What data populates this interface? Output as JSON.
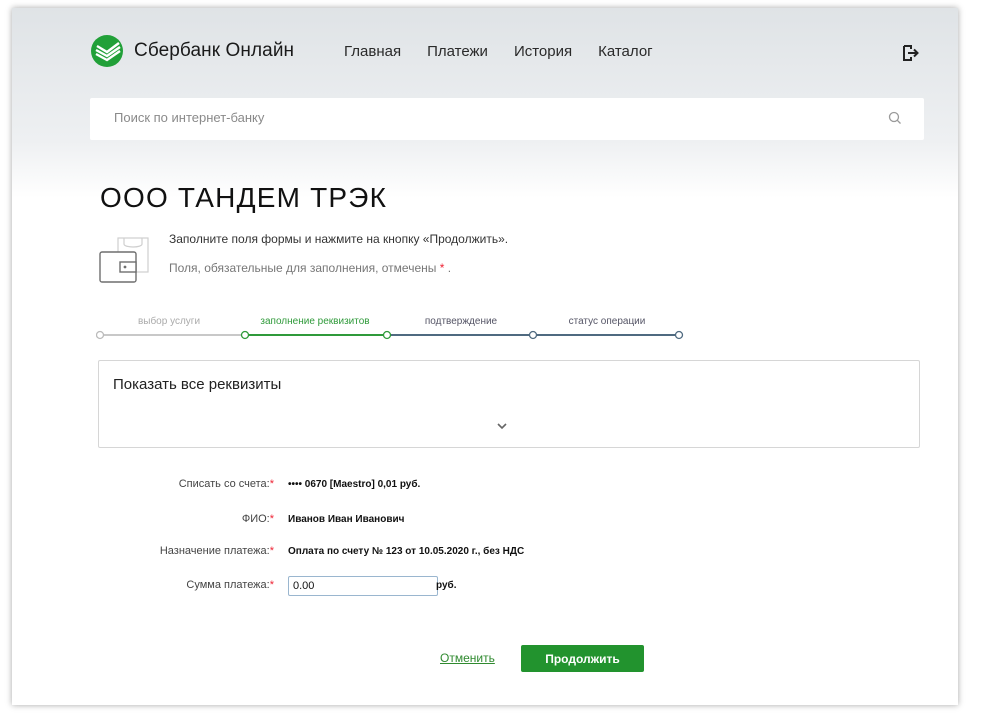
{
  "header": {
    "logo_text": "Сбербанк Онлайн",
    "nav": [
      "Главная",
      "Платежи",
      "История",
      "Каталог"
    ]
  },
  "search": {
    "placeholder": "Поиск по интернет-банку"
  },
  "page": {
    "title": "ООО ТАНДЕМ ТРЭК",
    "hint_main": "Заполните поля формы и нажмите на кнопку «Продолжить».",
    "hint_required": "Поля, обязательные для заполнения, отмечены",
    "required_mark": "*",
    "hint_end": "."
  },
  "steps": [
    {
      "label": "выбор услуги",
      "state": "done"
    },
    {
      "label": "заполнение реквизитов",
      "state": "active"
    },
    {
      "label": "подтверждение",
      "state": "pending"
    },
    {
      "label": "статус операции",
      "state": "pending"
    }
  ],
  "details": {
    "title": "Показать все реквизиты"
  },
  "form": {
    "rows": [
      {
        "label": "Списать со счета:",
        "value": "•••• 0670  [Maestro] 0,01   руб."
      },
      {
        "label": "ФИО:",
        "value": "Иванов Иван Иванович"
      },
      {
        "label": "Назначение платежа:",
        "value": "Оплата по счету № 123 от 10.05.2020 г., без НДС"
      }
    ],
    "amount_label": "Сумма платежа:",
    "amount_value": "0.00",
    "amount_unit": "руб.",
    "required_mark": "*"
  },
  "actions": {
    "cancel": "Отменить",
    "continue": "Продолжить"
  },
  "colors": {
    "brand_green": "#22932e",
    "active_step": "#2f9a3a",
    "pending_step": "#4f6a80",
    "required": "#e22233"
  }
}
